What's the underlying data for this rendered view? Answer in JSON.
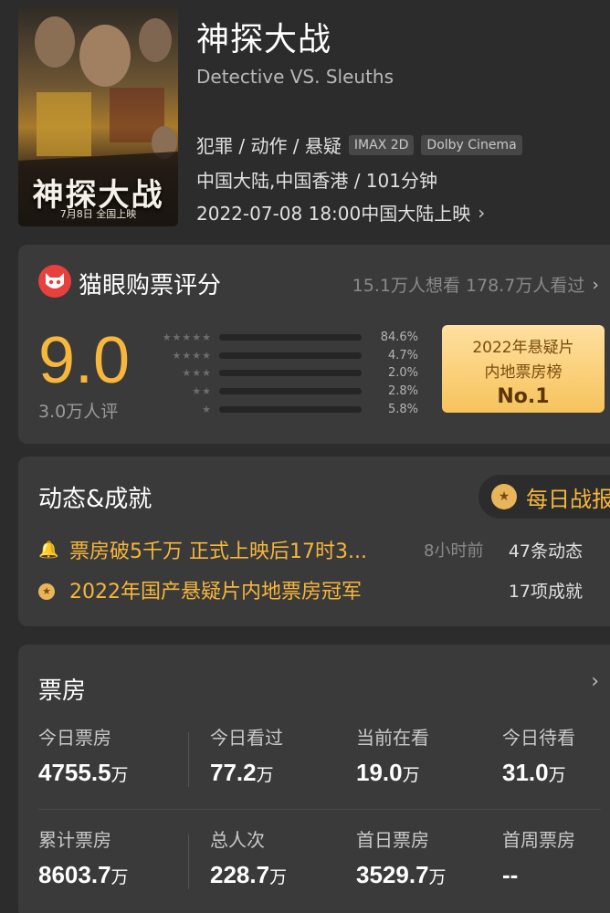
{
  "movie": {
    "title": "神探大战",
    "subtitle": "Detective VS. Sleuths",
    "genres": "犯罪 / 动作 / 悬疑",
    "tags": [
      "IMAX 2D",
      "Dolby Cinema"
    ],
    "region_duration": "中国大陆,中国香港 / 101分钟",
    "release": "2022-07-08 18:00中国大陆上映",
    "poster": {
      "title_art": "神探大战",
      "date_text": "7月8日 全国上映"
    }
  },
  "rating": {
    "heading": "猫眼购票评分",
    "want_watched": "15.1万人想看 178.7万人看过",
    "score": "9.0",
    "count": "3.0万人评",
    "distribution": [
      {
        "stars": "★★★★★",
        "percent": "84.6%",
        "fraction": 0.846
      },
      {
        "stars": "★★★★",
        "percent": "4.7%",
        "fraction": 0.047
      },
      {
        "stars": "★★★",
        "percent": "2.0%",
        "fraction": 0.02
      },
      {
        "stars": "★★",
        "percent": "2.8%",
        "fraction": 0.028
      },
      {
        "stars": "★",
        "percent": "5.8%",
        "fraction": 0.058
      }
    ],
    "rank": {
      "line1": "2022年悬疑片",
      "line2": "内地票房榜",
      "no": "No.1"
    }
  },
  "dynamics": {
    "heading": "动态&成就",
    "daily_button": "每日战报",
    "row1": {
      "text": "票房破5千万 正式上映后17时3...",
      "time": "8小时前",
      "count": "47条动态"
    },
    "row2": {
      "text": "2022年国产悬疑片内地票房冠军",
      "count": "17项成就"
    }
  },
  "box_office": {
    "heading": "票房",
    "stats": [
      {
        "label": "今日票房",
        "value": "4755.5",
        "unit": "万"
      },
      {
        "label": "今日看过",
        "value": "77.2",
        "unit": "万"
      },
      {
        "label": "当前在看",
        "value": "19.0",
        "unit": "万"
      },
      {
        "label": "今日待看",
        "value": "31.0",
        "unit": "万"
      },
      {
        "label": "累计票房",
        "value": "8603.7",
        "unit": "万"
      },
      {
        "label": "总人次",
        "value": "228.7",
        "unit": "万"
      },
      {
        "label": "首日票房",
        "value": "3529.7",
        "unit": "万"
      },
      {
        "label": "首周票房",
        "value": "--",
        "unit": ""
      }
    ]
  },
  "colors": {
    "accent": "#f6b73c",
    "background": "#2c2c2c",
    "card": "#3a3a3a",
    "brand_red": "#e8403c"
  }
}
